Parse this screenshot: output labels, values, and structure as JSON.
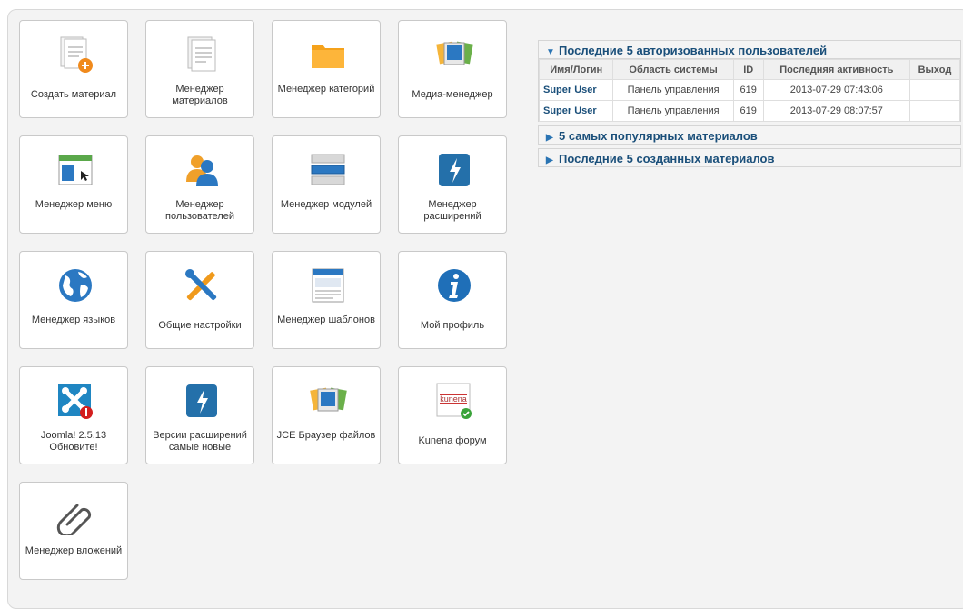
{
  "quickicons": [
    {
      "label": "Создать материал",
      "icon": "article-add-icon"
    },
    {
      "label": "Менеджер материалов",
      "icon": "article-manager-icon"
    },
    {
      "label": "Менеджер категорий",
      "icon": "category-folder-icon"
    },
    {
      "label": "Медиа-менеджер",
      "icon": "media-manager-icon"
    },
    {
      "label": "Менеджер меню",
      "icon": "menu-manager-icon"
    },
    {
      "label": "Менеджер пользователей",
      "icon": "user-manager-icon"
    },
    {
      "label": "Менеджер модулей",
      "icon": "module-manager-icon"
    },
    {
      "label": "Менеджер расширений",
      "icon": "extension-manager-icon"
    },
    {
      "label": "Менеджер языков",
      "icon": "language-globe-icon"
    },
    {
      "label": "Общие настройки",
      "icon": "global-config-tools-icon"
    },
    {
      "label": "Менеджер шаблонов",
      "icon": "template-manager-icon"
    },
    {
      "label": "Мой профиль",
      "icon": "profile-info-icon"
    },
    {
      "label": "Joomla! 2.5.13 Обновите!",
      "icon": "joomla-update-icon"
    },
    {
      "label": "Версии расширений самые новые",
      "icon": "extension-versions-icon"
    },
    {
      "label": "JCE Браузер файлов",
      "icon": "jce-file-browser-icon"
    },
    {
      "label": "Kunena форум",
      "icon": "kunena-forum-icon"
    },
    {
      "label": "Менеджер вложений",
      "icon": "attachments-paperclip-icon"
    }
  ],
  "logged": {
    "title": "Последние 5 авторизованных пользователей",
    "columns": [
      "Имя/Логин",
      "Область системы",
      "ID",
      "Последняя активность",
      "Выход"
    ],
    "rows": [
      [
        "Super User",
        "Панель управления",
        "619",
        "2013-07-29 07:43:06",
        ""
      ],
      [
        "Super User",
        "Панель управления",
        "619",
        "2013-07-29 08:07:57",
        ""
      ]
    ]
  },
  "popular": {
    "title": "5 самых популярных материалов"
  },
  "latest": {
    "title": "Последние 5 созданных материалов"
  },
  "colors": {
    "link": "#1a4f7a",
    "panel": "#f3f3f3",
    "accent": "#2a74b3"
  }
}
